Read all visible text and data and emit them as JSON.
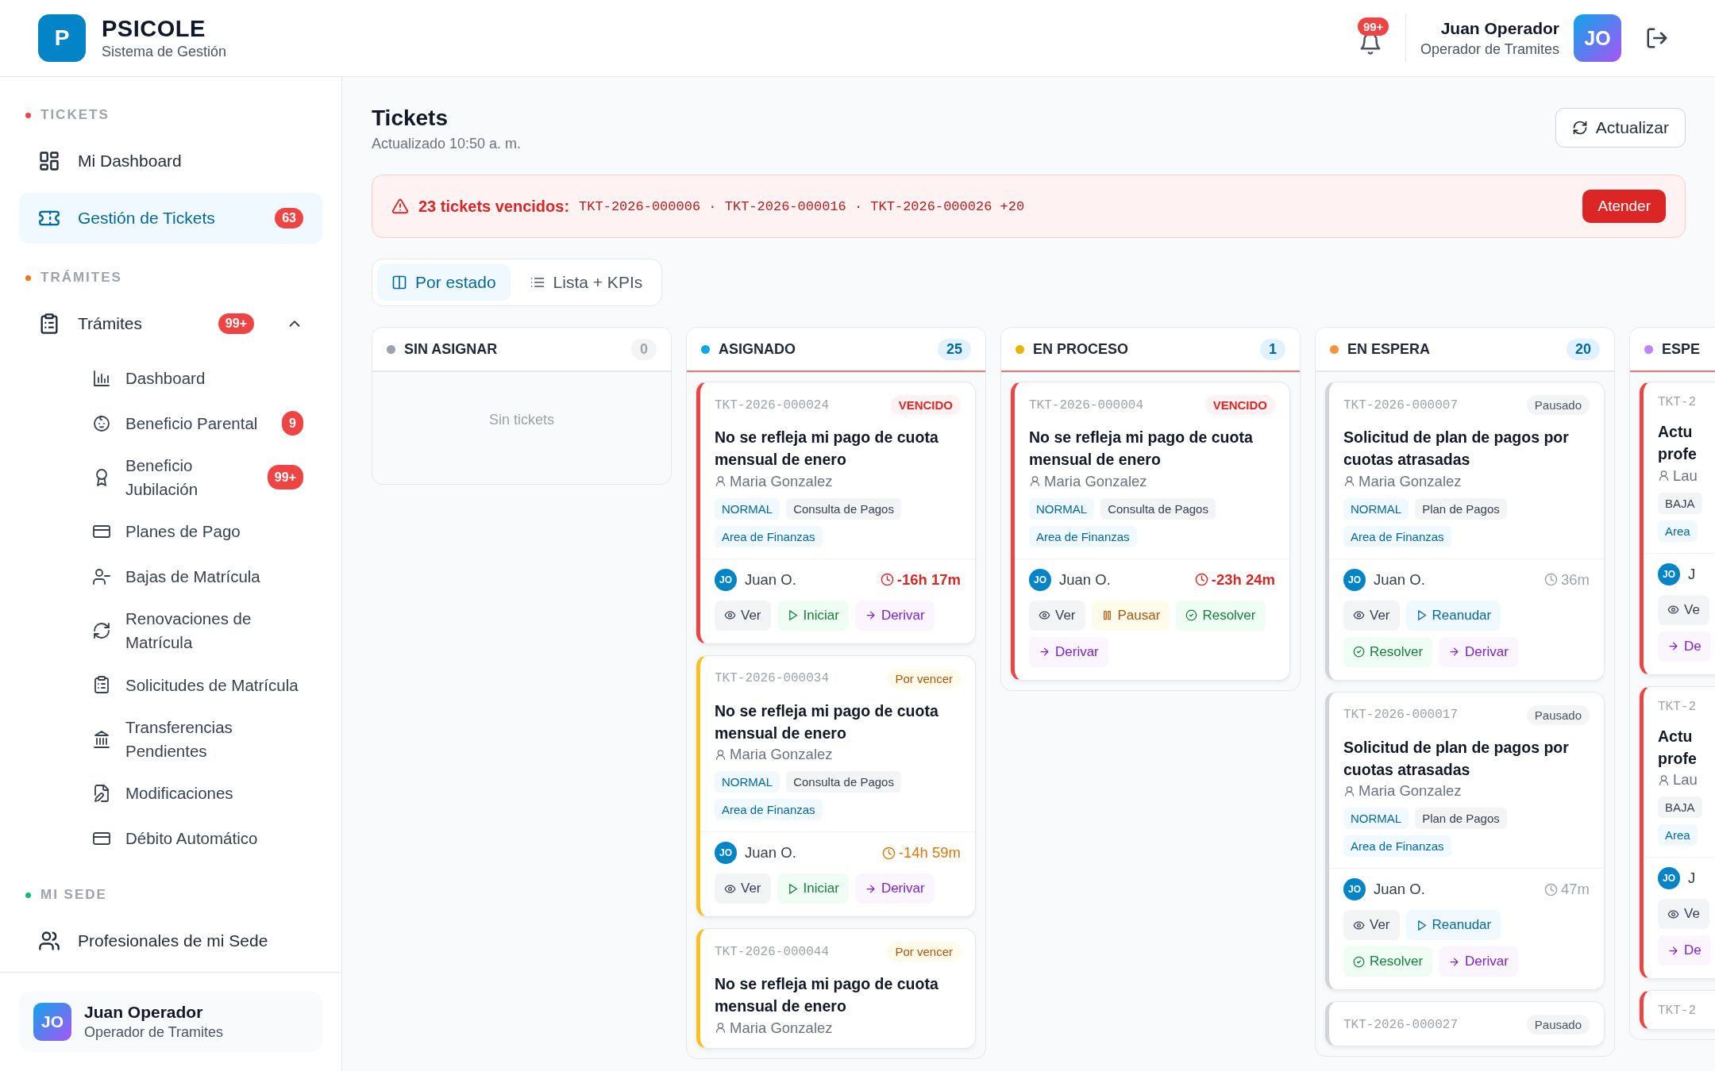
{
  "header": {
    "logo": "P",
    "brand": "PSICOLE",
    "subtitle": "Sistema de Gestión",
    "notifications": {
      "badge": "99+"
    },
    "user": {
      "name": "Juan Operador",
      "role": "Operador de Tramites",
      "initials": "JO"
    }
  },
  "sidebar": {
    "sections": [
      {
        "title": "TICKETS",
        "color": "#ef4444",
        "items": [
          {
            "label": "Mi Dashboard",
            "selected": false
          },
          {
            "label": "Gestión de Tickets",
            "selected": true,
            "badge": "63"
          }
        ]
      },
      {
        "title": "TRÁMITES",
        "color": "#f97316",
        "items": [
          {
            "label": "Trámites",
            "selected": false,
            "badge": "99+",
            "expanded": true,
            "children": [
              {
                "label": "Dashboard",
                "selected": false
              },
              {
                "label": "Beneficio Parental",
                "selected": false,
                "badge": "9"
              },
              {
                "label": "Beneficio\nJubilación",
                "selected": false,
                "badge": "99+"
              },
              {
                "label": "Planes de Pago",
                "selected": false
              },
              {
                "label": "Bajas de Matrícula",
                "selected": false
              },
              {
                "label": "Renovaciones de\nMatrícula",
                "selected": false
              },
              {
                "label": "Solicitudes de Matrícula",
                "selected": false
              },
              {
                "label": "Transferencias\nPendientes",
                "selected": false
              },
              {
                "label": "Modificaciones",
                "selected": false
              },
              {
                "label": "Débito Automático",
                "selected": false
              }
            ]
          }
        ]
      },
      {
        "title": "MI SEDE",
        "color": "#10b981",
        "items": [
          {
            "label": "Profesionales de mi Sede",
            "selected": false
          }
        ]
      }
    ],
    "user": {
      "name": "Juan Operador",
      "role": "Operador de Tramites",
      "initials": "JO"
    }
  },
  "page": {
    "title": "Tickets",
    "updated": "Actualizado 10:50 a. m.",
    "refresh_button": "Actualizar"
  },
  "alert": {
    "title": "23 tickets vencidos:",
    "tickets": "TKT-2026-000006 · TKT-2026-000016 · TKT-2026-000026 +20",
    "button": "Atender"
  },
  "view_tabs": [
    {
      "label": "Por estado",
      "selected": true
    },
    {
      "label": "Lista + KPIs",
      "selected": false
    }
  ],
  "columns": [
    {
      "name": "SIN ASIGNAR",
      "color": "#9ca3af",
      "count": "0",
      "overdue": false,
      "clipped": false,
      "empty_text": "Sin tickets"
    },
    {
      "name": "ASIGNADO",
      "color": "#0ea5e9",
      "count": "25",
      "overdue": true,
      "clipped": false,
      "cards": [
        {
          "id": "TKT-2026-000024",
          "kind": "overdue",
          "badge": "VENCIDO",
          "title": "No se refleja mi pago de cuota mensual de enero",
          "requester": "Maria Gonzalez",
          "tags": [
            {
              "text": "NORMAL",
              "kind": "priority"
            },
            {
              "text": "Consulta de Pagos",
              "kind": "category"
            },
            {
              "text": "Area de Finanzas",
              "kind": "area"
            }
          ],
          "assignee": {
            "initials": "JO",
            "name": "Juan O."
          },
          "timer": {
            "text": "-16h 17m",
            "kind": "overdue"
          },
          "actions": [
            {
              "label": "Ver",
              "kind": "view"
            },
            {
              "label": "Iniciar",
              "kind": "start"
            },
            {
              "label": "Derivar",
              "kind": "forward"
            }
          ]
        },
        {
          "id": "TKT-2026-000034",
          "kind": "due_soon",
          "badge": "Por vencer",
          "title": "No se refleja mi pago de cuota mensual de enero",
          "requester": "Maria Gonzalez",
          "tags": [
            {
              "text": "NORMAL",
              "kind": "priority"
            },
            {
              "text": "Consulta de Pagos",
              "kind": "category"
            },
            {
              "text": "Area de Finanzas",
              "kind": "area"
            }
          ],
          "assignee": {
            "initials": "JO",
            "name": "Juan O."
          },
          "timer": {
            "text": "-14h 59m",
            "kind": "due_soon"
          },
          "actions": [
            {
              "label": "Ver",
              "kind": "view"
            },
            {
              "label": "Iniciar",
              "kind": "start"
            },
            {
              "label": "Derivar",
              "kind": "forward"
            }
          ]
        },
        {
          "id": "TKT-2026-000044",
          "kind": "due_soon",
          "badge": "Por vencer",
          "title": "No se refleja mi pago de cuota mensual de enero",
          "requester": "Maria Gonzalez"
        }
      ]
    },
    {
      "name": "EN PROCESO",
      "color": "#eab308",
      "count": "1",
      "overdue": true,
      "clipped": false,
      "cards": [
        {
          "id": "TKT-2026-000004",
          "kind": "overdue",
          "badge": "VENCIDO",
          "title": "No se refleja mi pago de cuota mensual de enero",
          "requester": "Maria Gonzalez",
          "tags": [
            {
              "text": "NORMAL",
              "kind": "priority"
            },
            {
              "text": "Consulta de Pagos",
              "kind": "category"
            },
            {
              "text": "Area de Finanzas",
              "kind": "area"
            }
          ],
          "assignee": {
            "initials": "JO",
            "name": "Juan O."
          },
          "timer": {
            "text": "-23h 24m",
            "kind": "overdue"
          },
          "actions": [
            {
              "label": "Ver",
              "kind": "view"
            },
            {
              "label": "Pausar",
              "kind": "pause"
            },
            {
              "label": "Resolver",
              "kind": "resolve"
            },
            {
              "label": "Derivar",
              "kind": "forward"
            }
          ]
        }
      ]
    },
    {
      "name": "EN ESPERA",
      "color": "#fb923c",
      "count": "20",
      "overdue": false,
      "clipped": false,
      "cards": [
        {
          "id": "TKT-2026-000007",
          "kind": "paused",
          "badge": "Pausado",
          "title": "Solicitud de plan de pagos por cuotas atrasadas",
          "requester": "Maria Gonzalez",
          "tags": [
            {
              "text": "NORMAL",
              "kind": "priority"
            },
            {
              "text": "Plan de Pagos",
              "kind": "category"
            },
            {
              "text": "Area de Finanzas",
              "kind": "area"
            }
          ],
          "assignee": {
            "initials": "JO",
            "name": "Juan O."
          },
          "timer": {
            "text": "36m",
            "kind": "normal"
          },
          "actions": [
            {
              "label": "Ver",
              "kind": "view"
            },
            {
              "label": "Reanudar",
              "kind": "resume"
            },
            {
              "label": "Resolver",
              "kind": "resolve"
            },
            {
              "label": "Derivar",
              "kind": "forward"
            }
          ]
        },
        {
          "id": "TKT-2026-000017",
          "kind": "paused",
          "badge": "Pausado",
          "title": "Solicitud de plan de pagos por cuotas atrasadas",
          "requester": "Maria Gonzalez",
          "tags": [
            {
              "text": "NORMAL",
              "kind": "priority"
            },
            {
              "text": "Plan de Pagos",
              "kind": "category"
            },
            {
              "text": "Area de Finanzas",
              "kind": "area"
            }
          ],
          "assignee": {
            "initials": "JO",
            "name": "Juan O."
          },
          "timer": {
            "text": "47m",
            "kind": "normal"
          },
          "actions": [
            {
              "label": "Ver",
              "kind": "view"
            },
            {
              "label": "Reanudar",
              "kind": "resume"
            },
            {
              "label": "Resolver",
              "kind": "resolve"
            },
            {
              "label": "Derivar",
              "kind": "forward"
            }
          ]
        },
        {
          "id": "TKT-2026-000027",
          "kind": "paused",
          "badge": "Pausado"
        }
      ]
    },
    {
      "name": "ESPE",
      "color": "#c084fc",
      "overdue": true,
      "clipped": true,
      "cards": [
        {
          "id": "TKT-2",
          "kind": "overdue",
          "title": "Actu\nprofe",
          "requester": "Lau",
          "tags": [
            {
              "text": "BAJA",
              "kind": "priority_low"
            },
            {
              "text": "Area",
              "kind": "area"
            }
          ],
          "assignee": {
            "initials": "JO",
            "name": "J"
          },
          "actions": [
            {
              "label": "Ve",
              "kind": "view"
            },
            {
              "label": "De",
              "kind": "forward"
            }
          ]
        },
        {
          "id": "TKT-2",
          "kind": "overdue",
          "title": "Actu\nprofe",
          "requester": "Lau",
          "tags": [
            {
              "text": "BAJA",
              "kind": "priority_low"
            },
            {
              "text": "Area",
              "kind": "area"
            }
          ],
          "assignee": {
            "initials": "JO",
            "name": "J"
          },
          "actions": [
            {
              "label": "Ve",
              "kind": "view"
            },
            {
              "label": "De",
              "kind": "forward"
            }
          ]
        },
        {
          "id": "TKT-2",
          "kind": "overdue"
        }
      ]
    }
  ]
}
